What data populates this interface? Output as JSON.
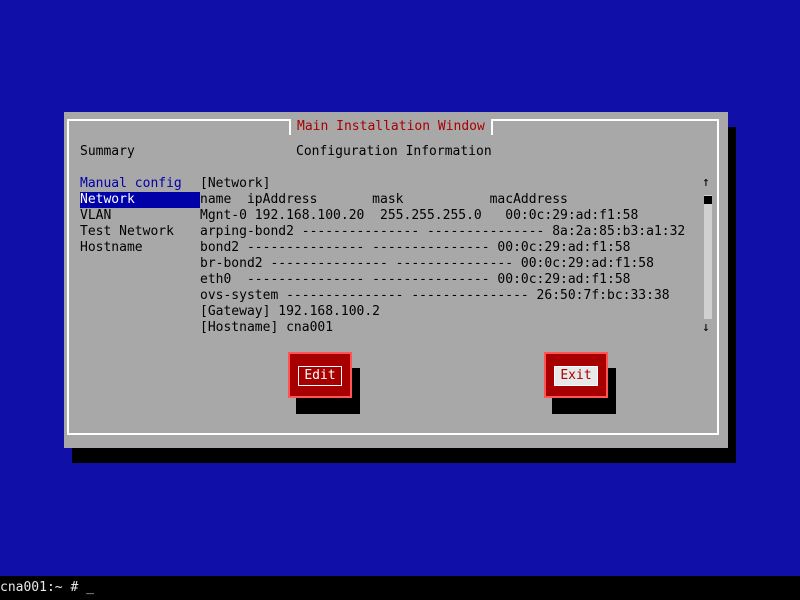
{
  "window": {
    "title": "Main Installation Window"
  },
  "left_panel": {
    "title": "Summary",
    "items": [
      {
        "label": "Manual config"
      },
      {
        "label": "Network"
      },
      {
        "label": "VLAN"
      },
      {
        "label": "Test Network"
      },
      {
        "label": "Hostname"
      }
    ]
  },
  "main": {
    "title": "Configuration Information",
    "lines": [
      "[Network]",
      "name  ipAddress       mask           macAddress",
      "Mgnt-0 192.168.100.20  255.255.255.0   00:0c:29:ad:f1:58",
      "arping-bond2 --------------- --------------- 8a:2a:85:b3:a1:32",
      "bond2 --------------- --------------- 00:0c:29:ad:f1:58",
      "br-bond2 --------------- --------------- 00:0c:29:ad:f1:58",
      "eth0  --------------- --------------- 00:0c:29:ad:f1:58",
      "ovs-system --------------- --------------- 26:50:7f:bc:33:38",
      "[Gateway] 192.168.100.2",
      "[Hostname] cna001"
    ]
  },
  "scrollbar": {
    "up_glyph": "↑",
    "down_glyph": "↓"
  },
  "buttons": {
    "edit_label": "Edit",
    "exit_label": "Exit"
  },
  "terminal": {
    "prompt": "cna001:~ # _"
  },
  "colors": {
    "background": "#1010a8",
    "window": "#a8a8a8",
    "title": "#a80000",
    "selection": "#0000a8",
    "button": "#a80000"
  }
}
